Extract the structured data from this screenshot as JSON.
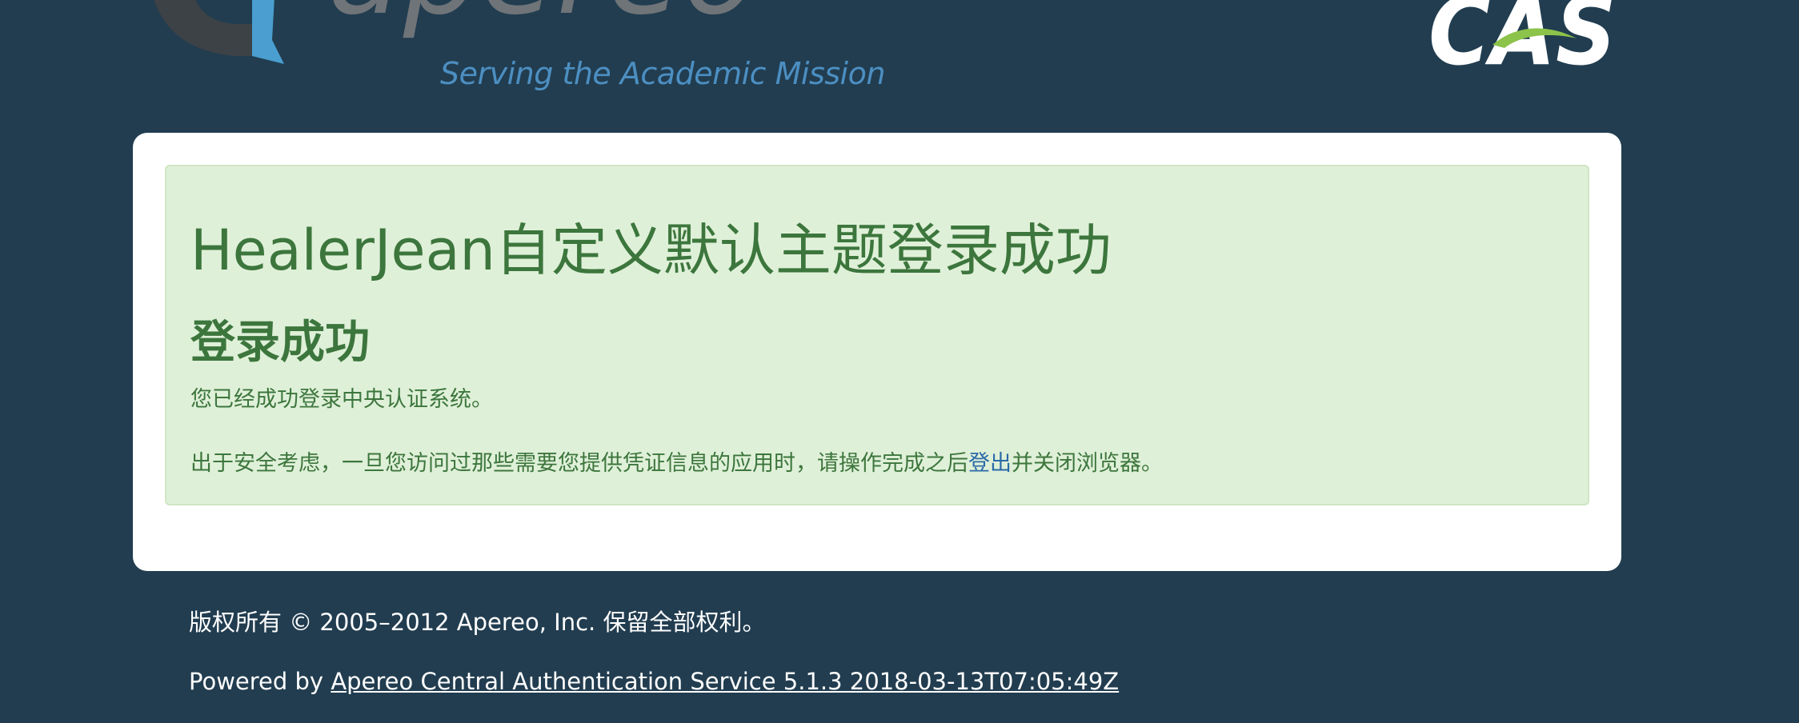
{
  "header": {
    "apereo_logo_text": "apereo",
    "apereo_tagline": "Serving the Academic Mission",
    "cas_logo_text": "CAS"
  },
  "card": {
    "theme_title": "HealerJean自定义默认主题登录成功",
    "heading": "登录成功",
    "message": "您已经成功登录中央认证系统。",
    "security_before": "出于安全考虑，一旦您访问过那些需要您提供凭证信息的应用时，请操作完成之后",
    "logout_link": "登出",
    "security_after": "并关闭浏览器。"
  },
  "footer": {
    "copyright": "版权所有 © 2005–2012 Apereo, Inc. 保留全部权利。",
    "powered_prefix": "Powered by ",
    "powered_link": "Apereo Central Authentication Service 5.1.3 2018-03-13T07:05:49Z"
  },
  "colors": {
    "background": "#223d50",
    "card": "#ffffff",
    "alert_bg": "#dff0d8",
    "alert_text": "#3c763d",
    "link": "#2a6aa8",
    "tagline": "#4c8fc2"
  }
}
